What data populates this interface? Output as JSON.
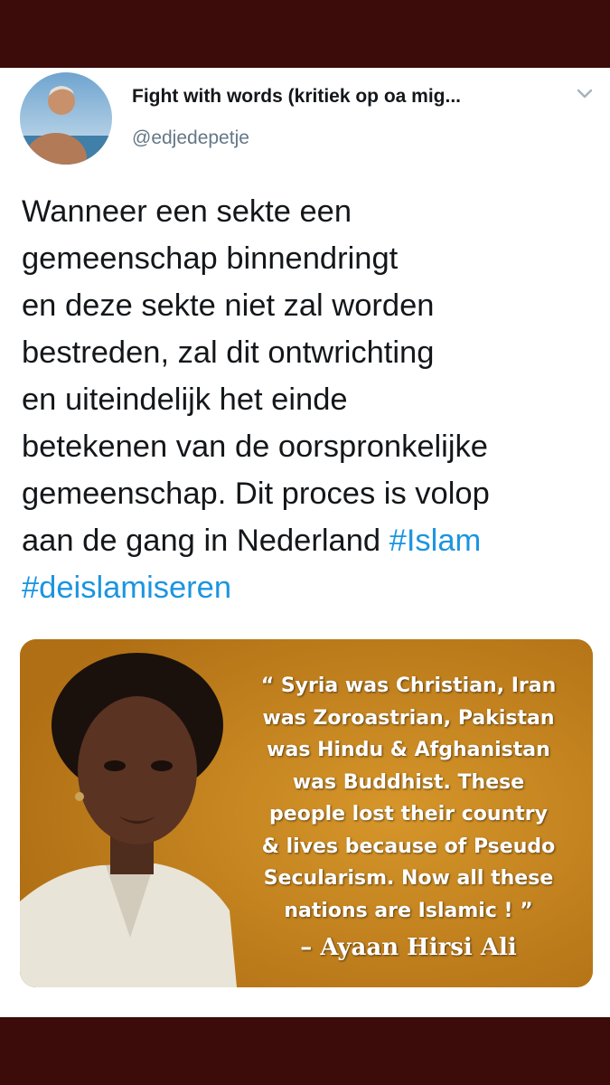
{
  "tweet": {
    "display_name": "Fight with words (kritiek op oa mig...",
    "handle": "@edjedepetje",
    "text_lines": [
      "Wanneer een sekte een",
      "gemeenschap binnendringt",
      "en deze sekte niet zal worden",
      "bestreden, zal dit ontwrichting",
      "en uiteindelijk het einde",
      "betekenen van de oorspronkelijke",
      "gemeenschap. Dit proces is volop",
      "aan de gang in Nederland "
    ],
    "hashtags": [
      "#Islam",
      "#deislamiseren"
    ],
    "menu_icon": "chevron-down-icon"
  },
  "media": {
    "quote": "“ Syria was Christian, Iran\nwas Zoroastrian, Pakistan\nwas Hindu & Afghanistan\nwas Buddhist. These\npeople lost their country\n& lives because of Pseudo\nSecularism. Now all these\nnations are Islamic ! ”",
    "attribution": "– Ayaan Hirsi Ali"
  },
  "colors": {
    "frame": "#3c0c0a",
    "hashtag": "#1b95e0",
    "handle": "#657786",
    "media_bg": "#c4851d"
  }
}
